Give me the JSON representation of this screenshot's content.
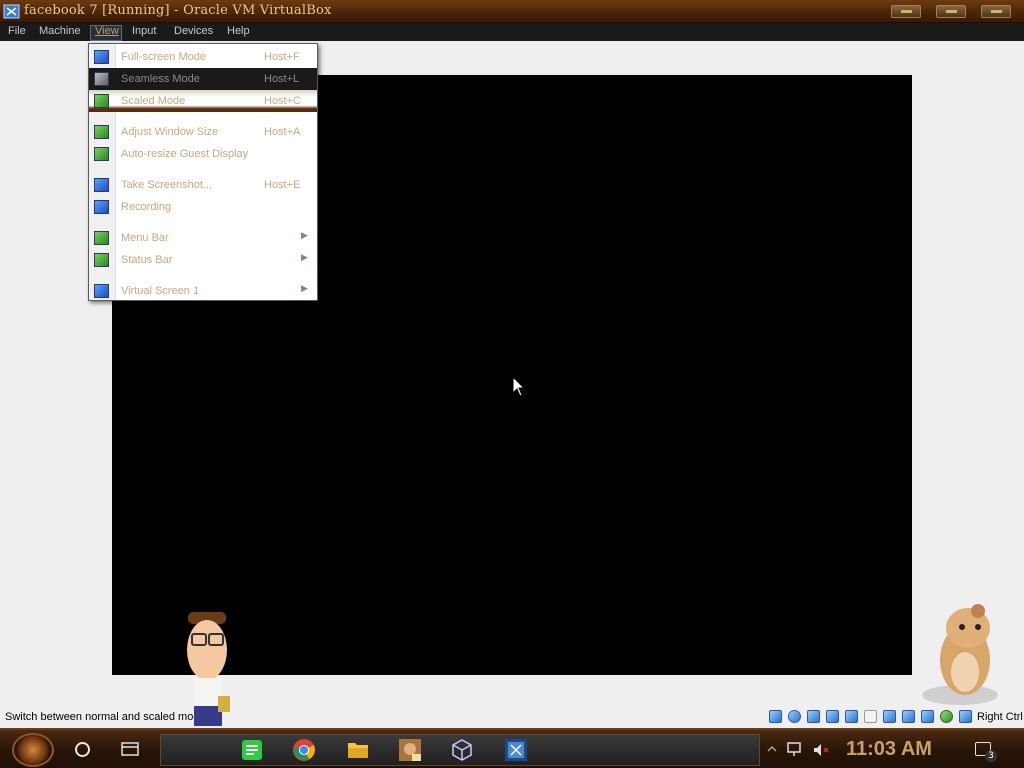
{
  "window": {
    "title": "facebook 7 [Running] - Oracle VM VirtualBox"
  },
  "menubar": {
    "items": [
      {
        "label": "File"
      },
      {
        "label": "Machine"
      },
      {
        "label": "View",
        "active": true
      },
      {
        "label": "Input"
      },
      {
        "label": "Devices"
      },
      {
        "label": "Help"
      }
    ]
  },
  "view_menu": {
    "items": [
      {
        "label": "Full-screen Mode",
        "shortcut": "Host+F",
        "icon": "fullscreen-icon"
      },
      {
        "label": "Seamless Mode",
        "shortcut": "Host+L",
        "icon": "seamless-icon",
        "highlighted": true
      },
      {
        "label": "Scaled Mode",
        "shortcut": "Host+C",
        "icon": "scaled-icon"
      },
      {
        "label": "Adjust Window Size",
        "shortcut": "Host+A",
        "icon": "adjust-window-icon"
      },
      {
        "label": "Auto-resize Guest Display",
        "shortcut": "",
        "icon": "auto-resize-icon",
        "checked": true
      },
      {
        "label": "Take Screenshot...",
        "shortcut": "Host+E",
        "icon": "screenshot-icon"
      },
      {
        "label": "Recording",
        "shortcut": "",
        "icon": "recording-icon"
      },
      {
        "label": "Menu Bar",
        "shortcut": "",
        "icon": "menu-bar-icon",
        "submenu": true
      },
      {
        "label": "Status Bar",
        "shortcut": "",
        "icon": "status-bar-icon",
        "submenu": true
      },
      {
        "label": "Virtual Screen 1",
        "shortcut": "",
        "icon": "virtual-screen-icon",
        "submenu": true
      }
    ]
  },
  "statusbar": {
    "hint": "Switch between normal and scaled mode",
    "host_key": "Right Ctrl"
  },
  "taskbar": {
    "clock": "11:03 AM",
    "notification_count": "3",
    "apps": [
      "notes-app-icon",
      "chrome-icon",
      "file-explorer-icon",
      "game-icon",
      "cube-app-icon",
      "virtualbox-icon"
    ]
  },
  "colors": {
    "titlebar": "#4a230a",
    "menu_text": "#c5a880",
    "vm_screen": "#000000",
    "clock": "#c8a060"
  }
}
